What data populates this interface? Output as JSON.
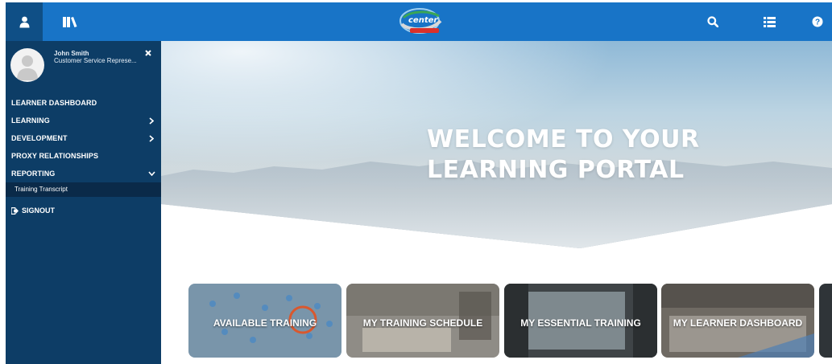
{
  "header": {
    "logo_text": "center",
    "icons": [
      "user-icon",
      "library-icon",
      "search-icon",
      "list-icon",
      "help-icon"
    ]
  },
  "sidebar": {
    "profile": {
      "name": "John Smith",
      "role": "Customer Service Represe..."
    },
    "items": [
      {
        "label": "LEARNER DASHBOARD",
        "chevron": ""
      },
      {
        "label": "LEARNING",
        "chevron": "right"
      },
      {
        "label": "DEVELOPMENT",
        "chevron": "right"
      },
      {
        "label": "PROXY RELATIONSHIPS",
        "chevron": ""
      },
      {
        "label": "REPORTING",
        "chevron": "down"
      }
    ],
    "subitem": "Training Transcript",
    "signout": "SIGNOUT"
  },
  "hero": {
    "line1": "WELCOME TO YOUR",
    "line2": "LEARNING PORTAL"
  },
  "tiles": [
    {
      "label": "AVAILABLE TRAINING"
    },
    {
      "label": "MY TRAINING SCHEDULE"
    },
    {
      "label": "MY ESSENTIAL TRAINING"
    },
    {
      "label": "MY LEARNER DASHBOARD"
    }
  ],
  "colors": {
    "topbar": "#1874c7",
    "sidebar": "#0d3d66",
    "sidebar_active": "#0a2a49",
    "user_button": "#0f4f86"
  }
}
